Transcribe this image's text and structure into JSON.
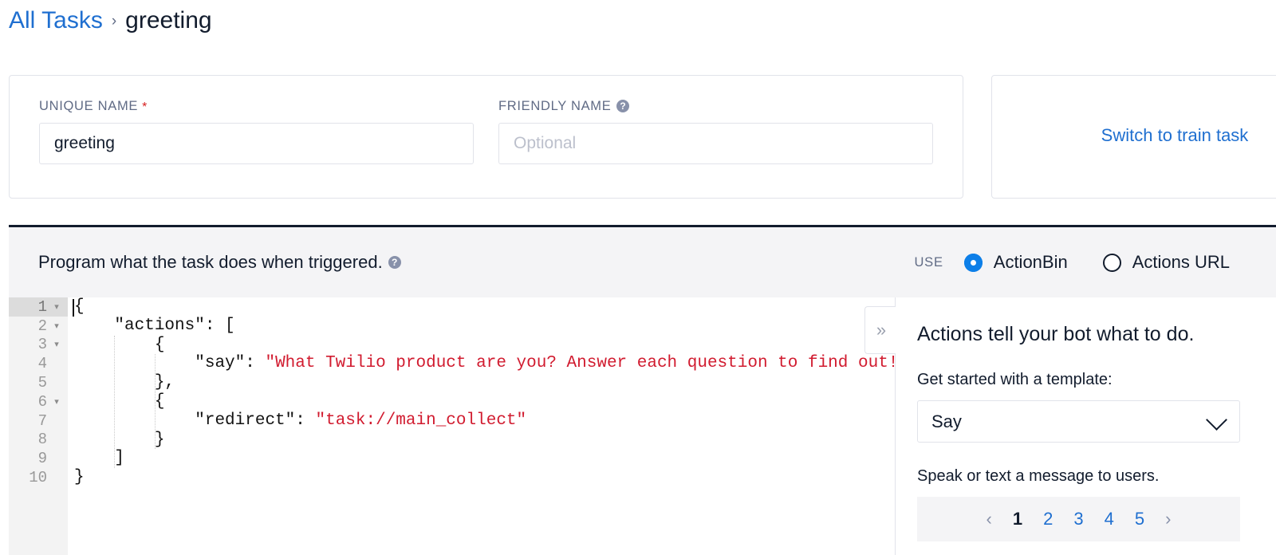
{
  "breadcrumb": {
    "parent_label": "All Tasks",
    "separator": "›",
    "current_label": "greeting"
  },
  "name_card": {
    "unique_name": {
      "label": "UNIQUE NAME",
      "required_marker": "*",
      "value": "greeting",
      "placeholder": ""
    },
    "friendly_name": {
      "label": "FRIENDLY NAME",
      "help_glyph": "?",
      "value": "",
      "placeholder": "Optional"
    }
  },
  "switch_card": {
    "link_label": "Switch to train task"
  },
  "program": {
    "title": "Program what the task does when triggered.",
    "help_glyph": "?",
    "use_label": "USE",
    "options": [
      {
        "label": "ActionBin",
        "selected": true
      },
      {
        "label": "Actions URL",
        "selected": false
      }
    ]
  },
  "editor": {
    "active_line": 1,
    "lines": [
      {
        "n": 1,
        "fold": true,
        "code": "{"
      },
      {
        "n": 2,
        "fold": true,
        "code": "    \"actions\": ["
      },
      {
        "n": 3,
        "fold": true,
        "code": "        {"
      },
      {
        "n": 4,
        "fold": false,
        "code": "            \"say\": \"What Twilio product are you? Answer each question to find out!\""
      },
      {
        "n": 5,
        "fold": false,
        "code": "        },"
      },
      {
        "n": 6,
        "fold": true,
        "code": "        {"
      },
      {
        "n": 7,
        "fold": false,
        "code": "            \"redirect\": \"task://main_collect\""
      },
      {
        "n": 8,
        "fold": false,
        "code": "        }"
      },
      {
        "n": 9,
        "fold": false,
        "code": "    ]"
      },
      {
        "n": 10,
        "fold": false,
        "code": "}"
      }
    ],
    "fold_glyph": "▾"
  },
  "right_panel": {
    "collapse_glyph": "»",
    "heading": "Actions tell your bot what to do.",
    "template_label": "Get started with a template:",
    "template_value": "Say",
    "template_description": "Speak or text a message to users.",
    "pagination": {
      "prev_glyph": "‹",
      "next_glyph": "›",
      "pages": [
        {
          "label": "1",
          "current": true
        },
        {
          "label": "2",
          "current": false
        },
        {
          "label": "3",
          "current": false
        },
        {
          "label": "4",
          "current": false
        },
        {
          "label": "5",
          "current": false
        }
      ]
    }
  },
  "colors": {
    "link_blue": "#1f6fd0",
    "radio_blue": "#0d7fe8",
    "string_red": "#d11b2f",
    "required_red": "#d61f1f",
    "header_bg": "#f4f4f6",
    "border": "#e1e3ea"
  }
}
